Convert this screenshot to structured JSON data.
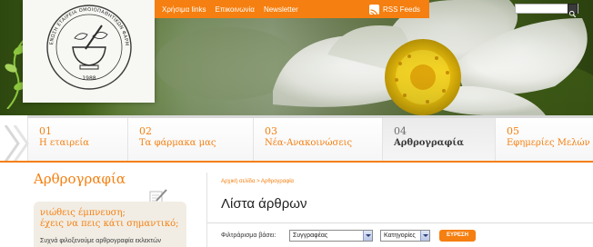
{
  "header": {
    "top_links": [
      {
        "label": "Χρήσιμα links"
      },
      {
        "label": "Επικοινωνία"
      },
      {
        "label": "Newsletter"
      }
    ],
    "rss_label": "RSS Feeds",
    "logo": {
      "text": "ΕΝΩΣΗ ΕΤΑΙΡΕΙΑ ΟΜΟΙΟΠΑΘΗΤΙΚΩΝ ΦΑΡΜΑΚΟΠΟΙΩΝ",
      "year": "1988"
    }
  },
  "nav": {
    "tabs": [
      {
        "num": "01",
        "label": "Η εταιρεία",
        "active": false
      },
      {
        "num": "02",
        "label": "Τα φάρμακα μας",
        "active": false
      },
      {
        "num": "03",
        "label": "Νέα-Ανακοινώσεις",
        "active": false
      },
      {
        "num": "04",
        "label": "Αρθρογραφία",
        "active": true
      },
      {
        "num": "05",
        "label": "Εφημερίες Μελών",
        "active": false
      }
    ]
  },
  "sidebar": {
    "title": "Αρθρογραφία",
    "slogan_line1": "νιώθεις έμπνευση;",
    "slogan_line2": "έχεις να πεις κάτι σημαντικό;",
    "text": "Συχνά φιλοξενούμε αρθρογραφία εκλεκτών"
  },
  "content": {
    "breadcrumb": "Αρχική σελίδα > Αρθρογραφία",
    "title": "Λίστα άρθρων",
    "filter_label": "Φιλτράρισμα βάσει:",
    "author_select": "Συγγραφέας",
    "category_select": "Κατηγορίες",
    "search_button": "ΕΥΡΕΣΗ"
  },
  "colors": {
    "accent": "#f57f10"
  }
}
